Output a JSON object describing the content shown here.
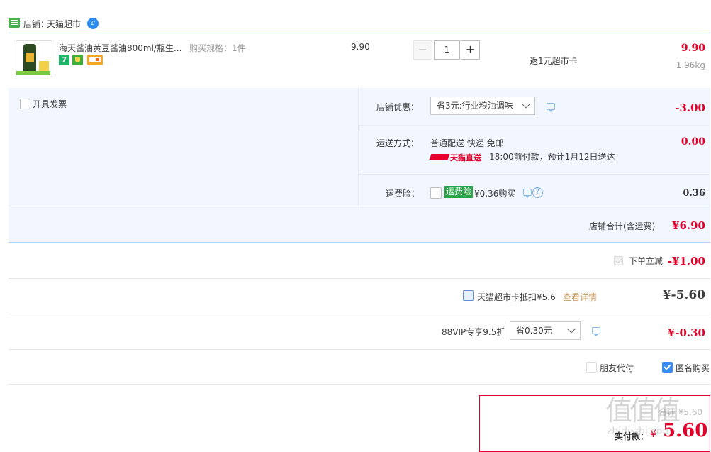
{
  "shop": {
    "label": "店铺：",
    "name": "天猫超市"
  },
  "item": {
    "title": "海天酱油黄豆酱油800ml/瓶生...",
    "spec": "购买规格：1件",
    "unit_price": "9.90",
    "quantity": "1",
    "rebate": "返1元超市卡",
    "subtotal": "9.90",
    "weight": "1.96kg",
    "badge_seven": "7"
  },
  "options": {
    "invoice_label": "开具发票",
    "shop_discount_label": "店铺优惠：",
    "shop_discount_value": "省3元:行业粮油调味",
    "shop_discount_amount": "-3.00",
    "shipping_label": "运送方式：",
    "shipping_method": "普通配送 快递 免邮",
    "shipping_brand": "天猫直送",
    "shipping_eta": "18:00前付款，预计1月12日送达",
    "shipping_amount": "0.00",
    "insurance_label": "运费险：",
    "insurance_tag": "运费险",
    "insurance_text": "¥0.36购买",
    "insurance_amount": "0.36",
    "shop_total_label": "店铺合计(含运费)",
    "shop_total_value": "¥6.90"
  },
  "discounts": {
    "instant_label": "下单立减",
    "instant_value": "-¥1.00",
    "card_label": "天猫超市卡抵扣¥5.6",
    "card_link": "查看详情",
    "card_value": "¥-5.60",
    "vip_label": "88VIP专享9.5折",
    "vip_select": "省0.30元",
    "vip_value": "¥-0.30",
    "friend_pay": "朋友代付",
    "anonymous": "匿名购买"
  },
  "payment": {
    "label": "实付款：",
    "currency": "¥",
    "amount": "5.60",
    "faded_text": "合计 ¥5.60"
  },
  "watermark": {
    "text": "值值值",
    "sub": "zhidezhi.com"
  },
  "colors": {
    "accent": "#f40",
    "crimson": "#e4002b",
    "link": "#c69a5f",
    "panel_bg": "#f2f7ff"
  }
}
